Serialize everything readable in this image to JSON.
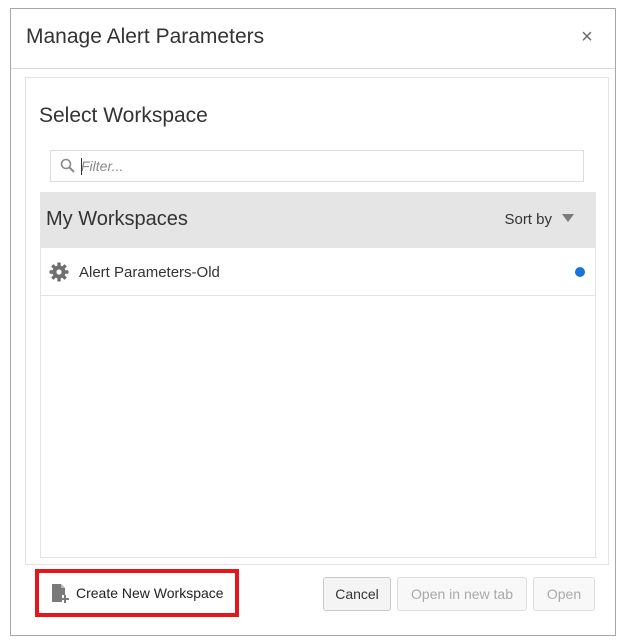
{
  "dialog": {
    "title": "Manage Alert Parameters",
    "close_glyph": "×"
  },
  "select_workspace": {
    "title": "Select Workspace",
    "filter_placeholder": "Filter..."
  },
  "list": {
    "header_title": "My Workspaces",
    "sort_label": "Sort by",
    "items": [
      {
        "label": "Alert Parameters-Old",
        "icon": "gear-icon",
        "status_color": "#1a73d9"
      }
    ]
  },
  "footer": {
    "create_label": "Create New Workspace",
    "create_icon": "new-document-icon",
    "highlight_color": "#e5171b",
    "cancel_label": "Cancel",
    "open_new_tab_label": "Open in new tab",
    "open_label": "Open"
  }
}
